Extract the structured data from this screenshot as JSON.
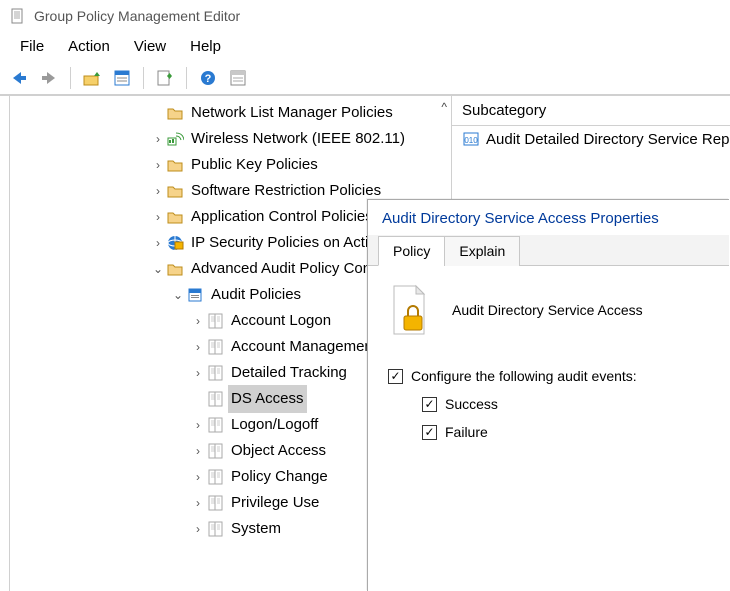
{
  "app": {
    "title": "Group Policy Management Editor"
  },
  "menu": {
    "file": "File",
    "action": "Action",
    "view": "View",
    "help": "Help"
  },
  "tree": {
    "scroll_indicator": "^",
    "items": [
      {
        "indent": 140,
        "exp": "",
        "icon": "folder",
        "label": "Network List Manager Policies"
      },
      {
        "indent": 140,
        "exp": ">",
        "icon": "wireless",
        "label": "Wireless Network (IEEE 802.11)"
      },
      {
        "indent": 140,
        "exp": ">",
        "icon": "folder",
        "label": "Public Key Policies"
      },
      {
        "indent": 140,
        "exp": ">",
        "icon": "folder",
        "label": "Software Restriction Policies"
      },
      {
        "indent": 140,
        "exp": ">",
        "icon": "folder",
        "label": "Application Control Policies"
      },
      {
        "indent": 140,
        "exp": ">",
        "icon": "ipsec",
        "label": "IP Security Policies on Active Directory"
      },
      {
        "indent": 140,
        "exp": "v",
        "icon": "folder",
        "label": "Advanced Audit Policy Configuration"
      },
      {
        "indent": 160,
        "exp": "v",
        "icon": "audit",
        "label": "Audit Policies"
      },
      {
        "indent": 180,
        "exp": ">",
        "icon": "policy",
        "label": "Account Logon"
      },
      {
        "indent": 180,
        "exp": ">",
        "icon": "policy",
        "label": "Account Management"
      },
      {
        "indent": 180,
        "exp": ">",
        "icon": "policy",
        "label": "Detailed Tracking"
      },
      {
        "indent": 180,
        "exp": "",
        "icon": "policy",
        "label": "DS Access",
        "selected": true
      },
      {
        "indent": 180,
        "exp": ">",
        "icon": "policy",
        "label": "Logon/Logoff"
      },
      {
        "indent": 180,
        "exp": ">",
        "icon": "policy",
        "label": "Object Access"
      },
      {
        "indent": 180,
        "exp": ">",
        "icon": "policy",
        "label": "Policy Change"
      },
      {
        "indent": 180,
        "exp": ">",
        "icon": "policy",
        "label": "Privilege Use"
      },
      {
        "indent": 180,
        "exp": ">",
        "icon": "policy",
        "label": "System"
      }
    ]
  },
  "list": {
    "header": "Subcategory",
    "items": [
      {
        "icon": "subcat",
        "label": "Audit Detailed Directory Service Replication"
      }
    ]
  },
  "dialog": {
    "title": "Audit Directory Service Access Properties",
    "tabs": {
      "policy": "Policy",
      "explain": "Explain"
    },
    "policy_name": "Audit Directory Service Access",
    "configure_label": "Configure the following audit events:",
    "success_label": "Success",
    "failure_label": "Failure",
    "configure_checked": true,
    "success_checked": true,
    "failure_checked": true
  }
}
